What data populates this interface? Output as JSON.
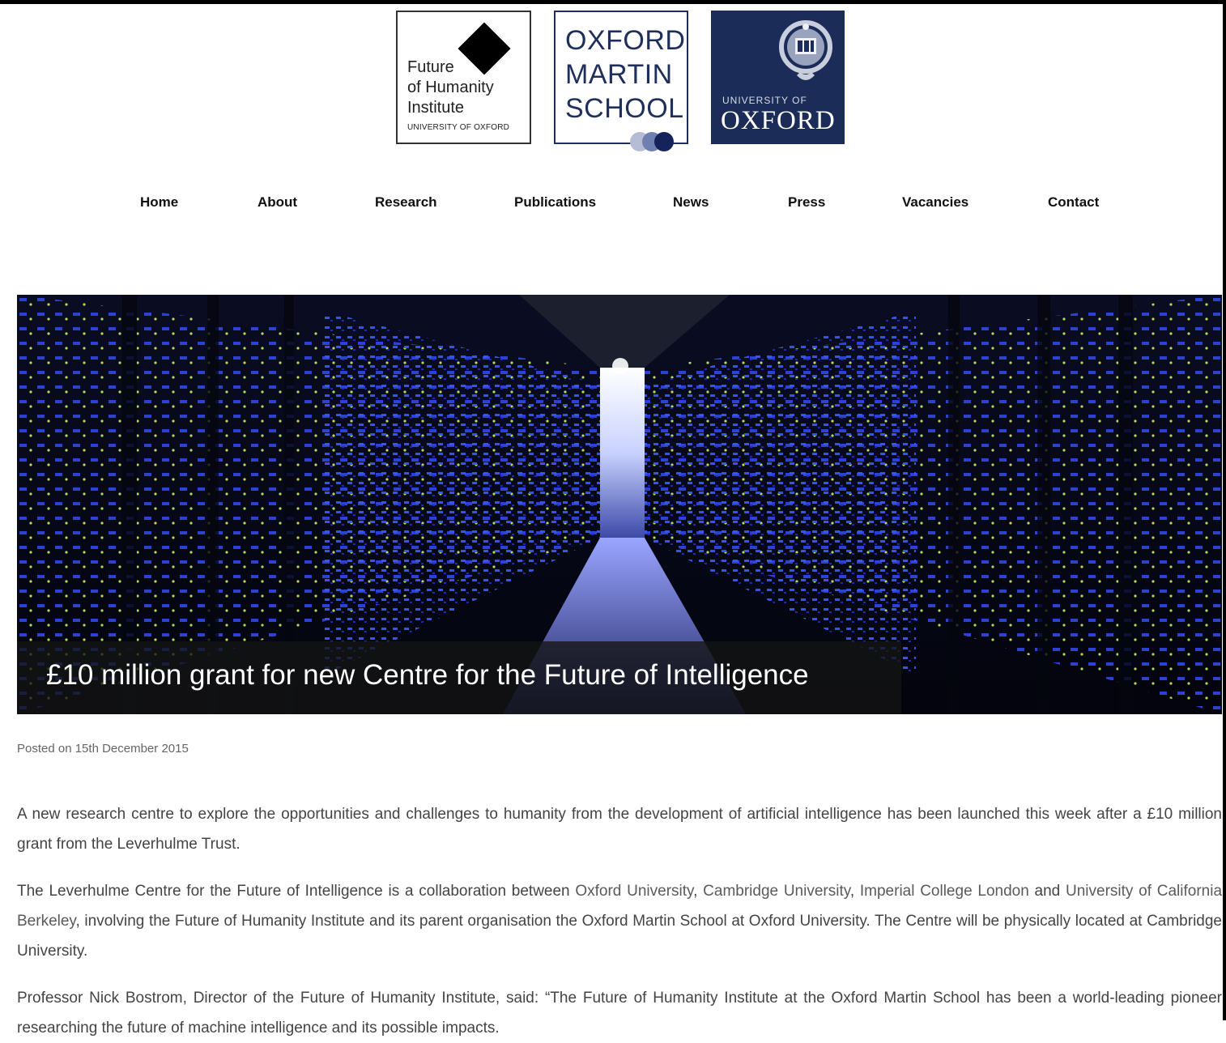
{
  "logos": {
    "fhi": {
      "lines": [
        "Future",
        "of Humanity",
        "Institute"
      ],
      "sub": "UNIVERSITY OF OXFORD"
    },
    "oms": {
      "lines": [
        "OXFORD",
        "MARTIN",
        "SCHOOL"
      ]
    },
    "oxford": {
      "univ": "UNIVERSITY OF",
      "name": "OXFORD"
    }
  },
  "nav": [
    "Home",
    "About",
    "Research",
    "Publications",
    "News",
    "Press",
    "Vacancies",
    "Contact"
  ],
  "hero": {
    "caption": "£10 million grant for new Centre for the Future of Intelligence"
  },
  "article": {
    "posted": "Posted on 15th December 2015",
    "p1": "A new research centre to explore the opportunities and challenges to humanity from the development of artificial intelligence has been launched this week after a £10 million grant from the Leverhulme Trust.",
    "p2": {
      "intro": "The Leverhulme Centre for the Future of Intelligence is a collaboration between ",
      "links": [
        "Oxford University",
        "Cambridge University",
        "Imperial College London",
        "University of California Berkeley"
      ],
      "sep1": ", ",
      "sep2": ", ",
      "sep3": " and ",
      "rest": ", involving the Future of Humanity Institute and its parent organisation the Oxford Martin School at Oxford University. The Centre will be physically located at Cambridge University."
    },
    "p3": "Professor Nick Bostrom, Director of the Future of Humanity Institute, said: “The Future of Humanity Institute at the Oxford Martin School has been a world-leading pioneer researching the future of machine intelligence and its possible impacts."
  },
  "colors": {
    "oxford_blue": "#1b2c58",
    "oms_blue": "#1f2f5c",
    "text": "#444444"
  }
}
